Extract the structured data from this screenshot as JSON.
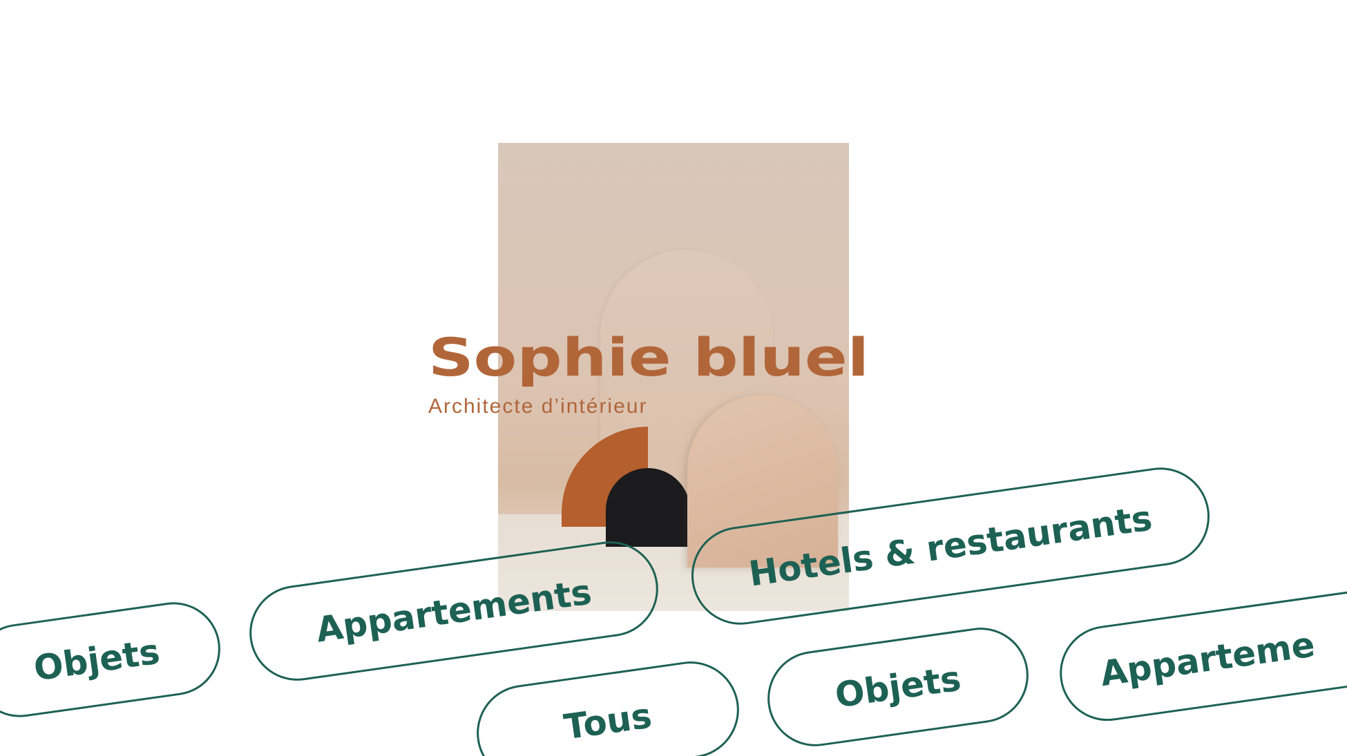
{
  "brand": {
    "title": "Sophie bluel",
    "subtitle": "Architecte d’intérieur"
  },
  "hero_image": {
    "description_icon": "hero-photo"
  },
  "filters": {
    "objets_1": "Objets",
    "appartements_1": "Appartements",
    "hotels_restaurants": "Hotels & restaurants",
    "tous": "Tous",
    "objets_2": "Objets",
    "appartements_2": "Apparteme"
  },
  "colors": {
    "brand": "#b1663a",
    "filter": "#1d6154",
    "background": "#ffffff"
  }
}
